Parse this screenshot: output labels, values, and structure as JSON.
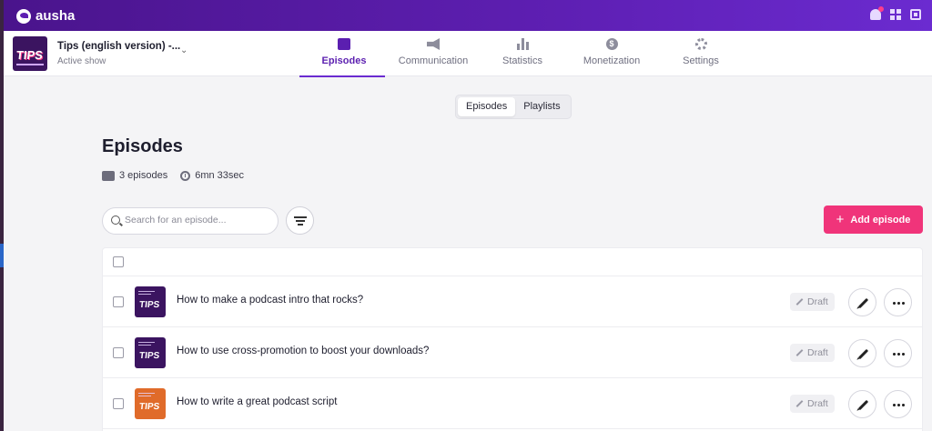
{
  "app": {
    "name": "ausha"
  },
  "topbar": {
    "icons": [
      "bell-icon",
      "gift-icon",
      "briefcase-icon"
    ]
  },
  "show": {
    "title": "Tips (english version) -...",
    "status": "Active show",
    "cover_text": "TIPS"
  },
  "nav": {
    "tabs": [
      {
        "label": "Episodes",
        "icon": "episodes-icon",
        "active": true
      },
      {
        "label": "Communication",
        "icon": "megaphone-icon",
        "active": false
      },
      {
        "label": "Statistics",
        "icon": "bar-chart-icon",
        "active": false
      },
      {
        "label": "Monetization",
        "icon": "dollar-icon",
        "active": false
      },
      {
        "label": "Settings",
        "icon": "gear-icon",
        "active": false
      }
    ]
  },
  "segment": {
    "episodes_label": "Episodes",
    "playlists_label": "Playlists",
    "selected": "Episodes"
  },
  "page": {
    "title": "Episodes",
    "episode_count": "3 episodes",
    "total_duration": "6mn 33sec"
  },
  "search": {
    "placeholder": "Search for an episode...",
    "value": ""
  },
  "actions": {
    "add_episode_label": "Add episode"
  },
  "episodes": [
    {
      "title": "How to make a podcast intro that rocks?",
      "status": "Draft",
      "cover_text": "TIPS",
      "cover_color": "#3b1460"
    },
    {
      "title": "How to use cross-promotion to boost your downloads?",
      "status": "Draft",
      "cover_text": "TIPS",
      "cover_color": "#3b1460"
    },
    {
      "title": "How to write a great podcast script",
      "status": "Draft",
      "cover_text": "TIPS",
      "cover_color": "#e06b2a"
    }
  ],
  "colors": {
    "brand_purple": "#5e1fb3",
    "accent_pink": "#f0347a",
    "active_tab": "#5b1fb0"
  }
}
